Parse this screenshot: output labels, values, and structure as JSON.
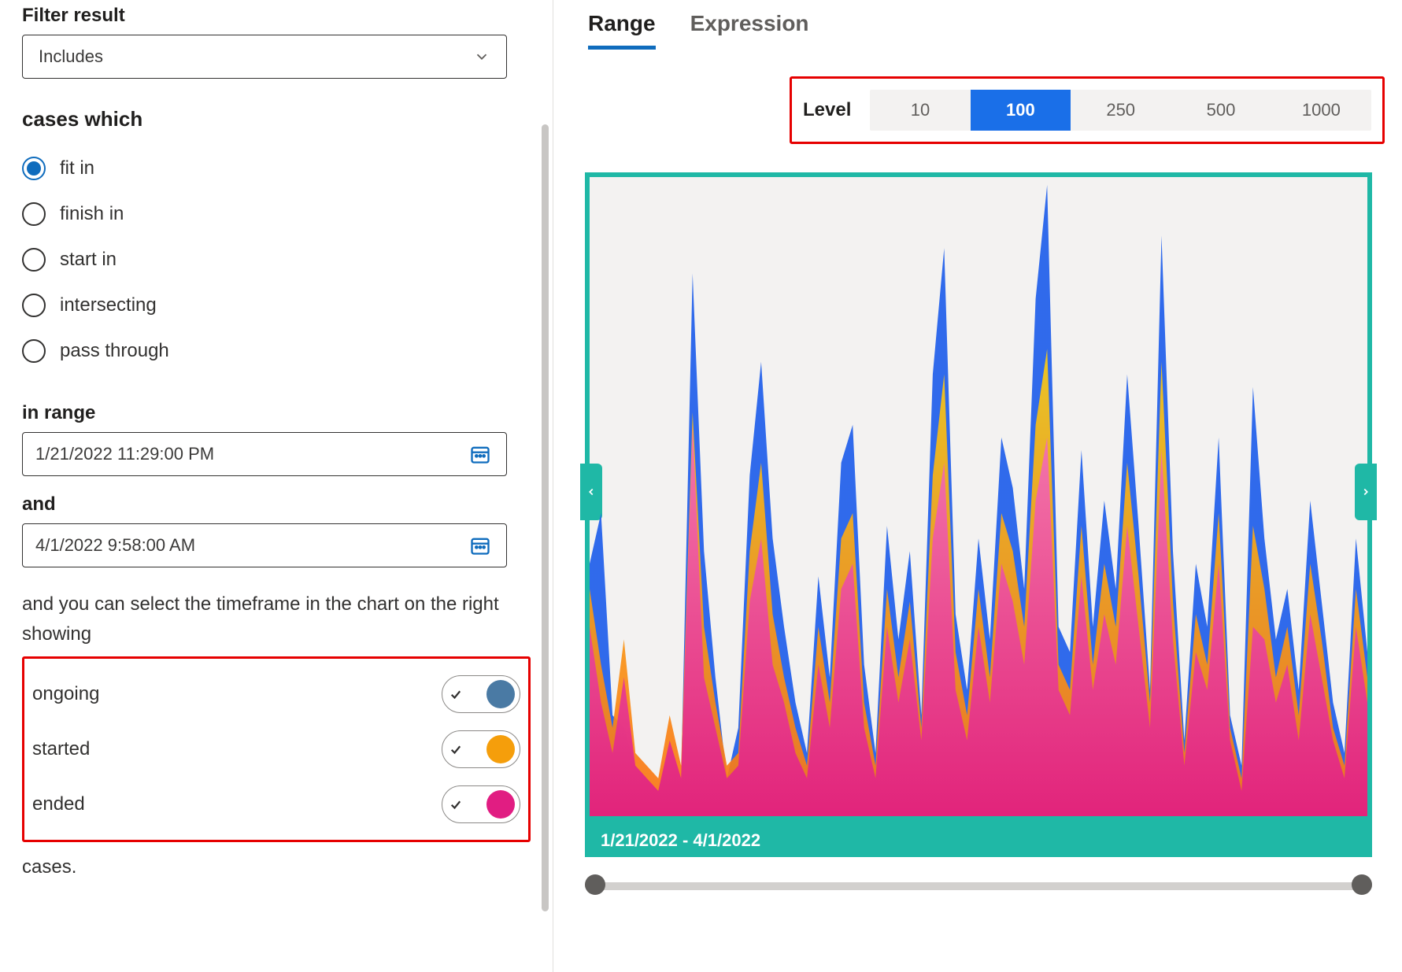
{
  "sidebar": {
    "filter_result_label": "Filter result",
    "filter_result_value": "Includes",
    "cases_which_label": "cases which",
    "radios": [
      {
        "label": "fit in",
        "selected": true
      },
      {
        "label": "finish in",
        "selected": false
      },
      {
        "label": "start in",
        "selected": false
      },
      {
        "label": "intersecting",
        "selected": false
      },
      {
        "label": "pass through",
        "selected": false
      }
    ],
    "in_range_label": "in range",
    "date_from": "1/21/2022 11:29:00 PM",
    "and_label": "and",
    "date_to": "4/1/2022 9:58:00 AM",
    "desc": "and you can select the timeframe in the chart on the right showing",
    "toggles": [
      {
        "label": "ongoing",
        "on": true,
        "color": "#4a7aa4"
      },
      {
        "label": "started",
        "on": true,
        "color": "#f59e0b"
      },
      {
        "label": "ended",
        "on": true,
        "color": "#e11d82"
      }
    ],
    "trailing": "cases."
  },
  "tabs": {
    "range": "Range",
    "expression": "Expression",
    "active": "range"
  },
  "level": {
    "label": "Level",
    "options": [
      "10",
      "100",
      "250",
      "500",
      "1000"
    ],
    "active_index": 1
  },
  "chart": {
    "date_range_label": "1/21/2022 - 4/1/2022"
  },
  "chart_data": {
    "type": "area",
    "xrange": [
      "1/21/2022",
      "4/1/2022"
    ],
    "ylim": [
      0,
      100
    ],
    "series": [
      {
        "name": "ongoing",
        "color_top": "#2563eb",
        "color_bot": "#2563eb",
        "values": [
          40,
          48,
          16,
          14,
          8,
          6,
          4,
          12,
          6,
          86,
          42,
          22,
          6,
          14,
          54,
          72,
          44,
          30,
          18,
          10,
          38,
          22,
          56,
          62,
          24,
          10,
          46,
          28,
          42,
          16,
          70,
          90,
          32,
          20,
          44,
          28,
          60,
          52,
          36,
          82,
          100,
          30,
          26,
          58,
          30,
          50,
          36,
          70,
          46,
          20,
          92,
          42,
          12,
          40,
          30,
          60,
          16,
          8,
          68,
          44,
          28,
          36,
          20,
          50,
          34,
          18,
          10,
          44,
          26
        ]
      },
      {
        "name": "started",
        "color_top": "#facc15",
        "color_bot": "#f97316",
        "values": [
          36,
          24,
          14,
          28,
          10,
          8,
          6,
          16,
          8,
          64,
          30,
          18,
          8,
          10,
          42,
          56,
          32,
          22,
          14,
          8,
          30,
          18,
          44,
          48,
          18,
          8,
          36,
          22,
          34,
          14,
          54,
          70,
          26,
          16,
          36,
          22,
          48,
          42,
          30,
          62,
          74,
          24,
          20,
          46,
          24,
          40,
          30,
          56,
          38,
          18,
          72,
          34,
          10,
          32,
          24,
          48,
          14,
          6,
          46,
          36,
          22,
          30,
          16,
          40,
          28,
          14,
          8,
          36,
          22
        ]
      },
      {
        "name": "ended",
        "color_top": "#f472b6",
        "color_bot": "#e11d82",
        "values": [
          30,
          18,
          10,
          22,
          8,
          6,
          4,
          12,
          6,
          62,
          22,
          14,
          6,
          8,
          34,
          44,
          24,
          18,
          10,
          6,
          24,
          14,
          36,
          40,
          14,
          6,
          30,
          18,
          28,
          12,
          44,
          56,
          20,
          12,
          30,
          18,
          40,
          34,
          24,
          50,
          60,
          20,
          16,
          38,
          20,
          32,
          24,
          46,
          30,
          14,
          58,
          28,
          8,
          26,
          20,
          40,
          12,
          4,
          30,
          28,
          18,
          24,
          12,
          32,
          22,
          12,
          6,
          30,
          18
        ]
      }
    ]
  }
}
